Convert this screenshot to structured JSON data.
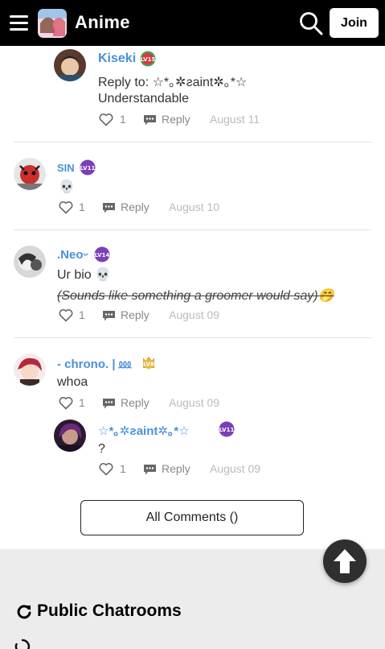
{
  "header": {
    "app_title": "Anime",
    "join_label": "Join"
  },
  "comments": [
    {
      "username": "Kiseki",
      "level": "LV15",
      "reply_to": "Reply to: ☆*｡✲ƨaint✲｡*☆",
      "text": "Understandable",
      "likes": "1",
      "reply_label": "Reply",
      "date": "August 11"
    },
    {
      "username": "SIN",
      "level": "LV11",
      "text": "💀",
      "likes": "1",
      "reply_label": "Reply",
      "date": "August 10"
    },
    {
      "username": ".Neoᵕ",
      "level": "LV14",
      "text": "Ur bio 💀",
      "text2": "(Sounds like something a groomer would say)🤭",
      "likes": "1",
      "reply_label": "Reply",
      "date": "August 09"
    },
    {
      "username": "- chrono. | ⅏",
      "level": "LV8",
      "text": "whoa",
      "likes": "1",
      "reply_label": "Reply",
      "date": "August 09"
    },
    {
      "username": "☆*｡✲ƨaint✲｡*☆",
      "level": "LV11",
      "text": "?",
      "likes": "1",
      "reply_label": "Reply",
      "date": "August 09"
    }
  ],
  "all_comments_label": "All Comments ()",
  "chatrooms": {
    "title": "Public Chatrooms"
  },
  "colors": {
    "username": "#4a90d9",
    "level_badge": "#7b3fb8",
    "header_bg": "#000000",
    "footer_bg": "#ececec"
  }
}
